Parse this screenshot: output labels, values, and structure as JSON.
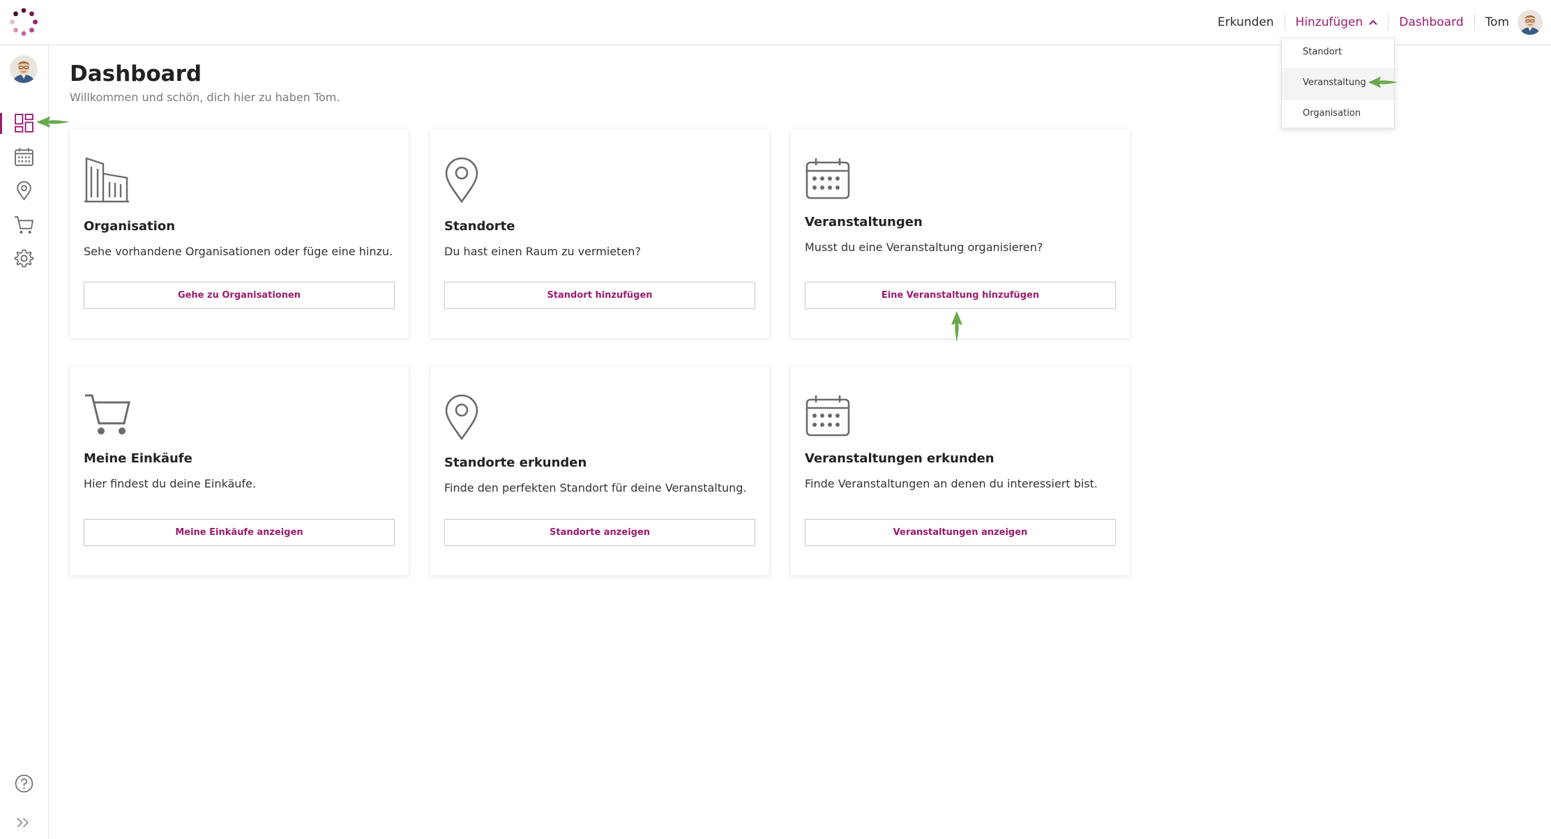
{
  "topnav": {
    "explore": "Erkunden",
    "add": "Hinzufügen",
    "dashboard": "Dashboard",
    "user_name": "Tom"
  },
  "add_menu": {
    "items": [
      "Standort",
      "Veranstaltung",
      "Organisation"
    ],
    "active_index": 1
  },
  "page": {
    "title": "Dashboard",
    "subtitle": "Willkommen und schön, dich hier zu haben Tom."
  },
  "cards": [
    {
      "icon": "building-icon",
      "title": "Organisation",
      "text": "Sehe vorhandene Organisationen oder füge eine hinzu.",
      "button": "Gehe zu Organisationen"
    },
    {
      "icon": "map-pin-icon",
      "title": "Standorte",
      "text": "Du hast einen Raum zu vermieten?",
      "button": "Standort hinzufügen"
    },
    {
      "icon": "calendar-icon",
      "title": "Veranstaltungen",
      "text": "Musst du eine Veranstaltung organisieren?",
      "button": "Eine Veranstaltung hinzufügen"
    },
    {
      "icon": "shopping-cart-icon",
      "title": "Meine Einkäufe",
      "text": "Hier findest du deine Einkäufe.",
      "button": "Meine Einkäufe anzeigen"
    },
    {
      "icon": "map-pin-icon",
      "title": "Standorte erkunden",
      "text": "Finde den perfekten Standort für deine Veranstaltung.",
      "button": "Standorte anzeigen"
    },
    {
      "icon": "calendar-icon",
      "title": "Veranstaltungen erkunden",
      "text": "Finde Veranstaltungen an denen du interessiert bist.",
      "button": "Veranstaltungen anzeigen"
    }
  ],
  "sidebar": {
    "icons": [
      "dashboard-icon",
      "calendar-icon",
      "map-pin-icon",
      "shopping-cart-icon",
      "gear-icon",
      "help-icon",
      "expand-icon"
    ],
    "active": "dashboard-icon"
  },
  "colors": {
    "accent": "#9b1c6e",
    "arrow": "#6aa84f",
    "icon_gray": "#6b6b6b"
  }
}
